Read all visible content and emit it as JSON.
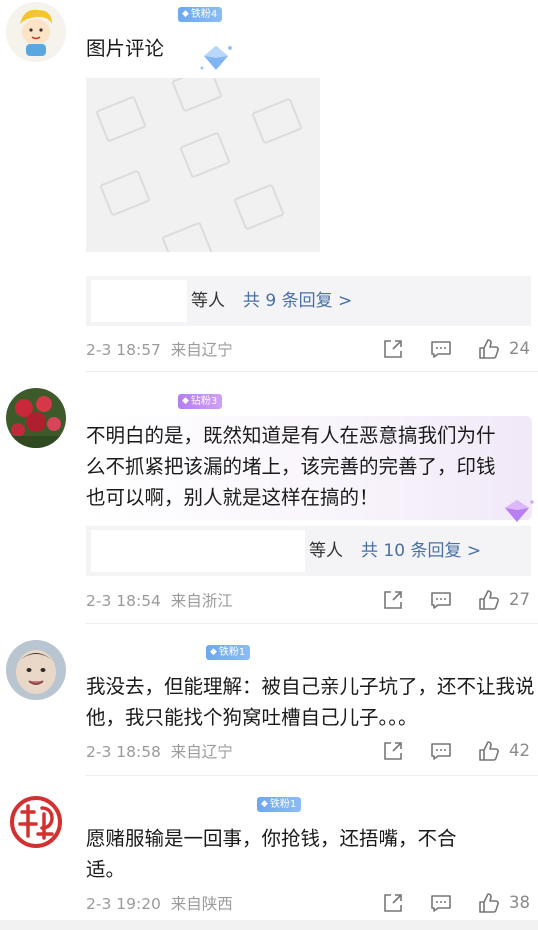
{
  "comments": [
    {
      "badge": "铁粉4",
      "text": "图片评论",
      "reply_names": "等人",
      "reply_link": "共 9 条回复 >",
      "time": "2-3 18:57",
      "location": "来自辽宁",
      "likes": "24"
    },
    {
      "badge": "钻粉3",
      "text": "不明白的是，既然知道是有人在恶意搞我们为什么不抓紧把该漏的堵上，该完善的完善了，印钱也可以啊，别人就是这样在搞的！",
      "reply_names": "等人",
      "reply_link": "共 10 条回复 >",
      "time": "2-3 18:54",
      "location": "来自浙江",
      "likes": "27"
    },
    {
      "badge": "铁粉1",
      "text": "我没去，但能理解：被自己亲儿子坑了，还不让我说他，我只能找个狗窝吐槽自己儿子。。。",
      "time": "2-3 18:58",
      "location": "来自辽宁",
      "likes": "42"
    },
    {
      "badge": "铁粉1",
      "text": "愿赌服输是一回事，你抢钱，还捂嘴，不合适。",
      "time": "2-3 19:20",
      "location": "来自陕西",
      "likes": "38"
    }
  ],
  "icons": {
    "share": "share-icon",
    "comment": "comment-icon",
    "like": "thumbs-up-icon"
  },
  "colors": {
    "link": "#4a6fa5",
    "meta": "#9b9b9b",
    "badge_blue": "#6ea8ee",
    "badge_purple": "#b57ef0"
  }
}
